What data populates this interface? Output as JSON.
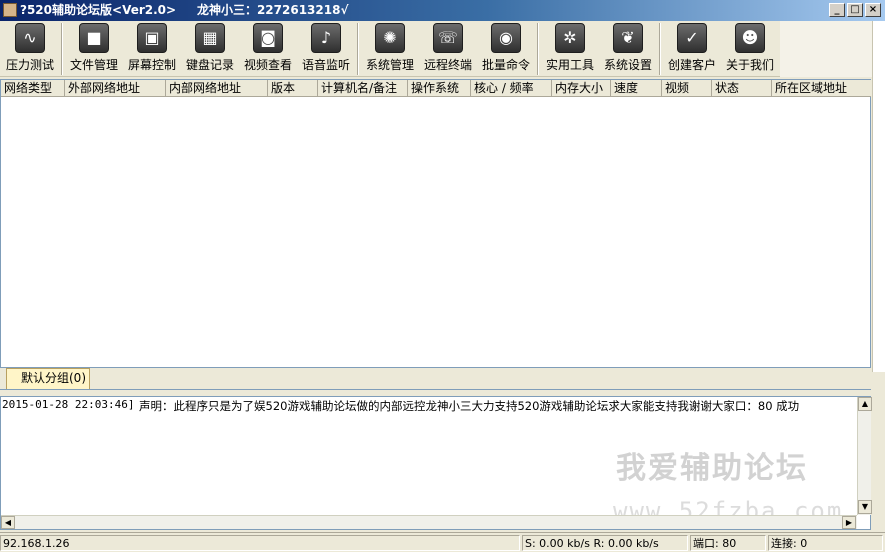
{
  "window": {
    "title": "?520辅助论坛版<Ver2.0>     龙神小三：2272613218√",
    "buttons": [
      "_",
      "□",
      "×"
    ]
  },
  "toolbar": {
    "items": [
      {
        "label": "压力测试",
        "icon": "pulse-icon"
      },
      {
        "label": "文件管理",
        "icon": "box-icon"
      },
      {
        "label": "屏幕控制",
        "icon": "photos-icon"
      },
      {
        "label": "键盘记录",
        "icon": "calendar-icon"
      },
      {
        "label": "视频查看",
        "icon": "camera-icon"
      },
      {
        "label": "语音监听",
        "icon": "microphone-icon"
      },
      {
        "label": "系统管理",
        "icon": "gears-icon"
      },
      {
        "label": "远程终端",
        "icon": "phone-icon"
      },
      {
        "label": "批量命令",
        "icon": "broadcast-icon"
      },
      {
        "label": "实用工具",
        "icon": "aperture-icon"
      },
      {
        "label": "系统设置",
        "icon": "leaf-icon"
      },
      {
        "label": "创建客户",
        "icon": "checkmark-icon"
      },
      {
        "label": "关于我们",
        "icon": "users-icon"
      }
    ]
  },
  "list": {
    "columns": [
      "网络类型",
      "外部网络地址",
      "内部网络地址",
      "版本",
      "计算机名/备注",
      "操作系统",
      "核心 / 频率",
      "内存大小",
      "速度",
      "视频",
      "状态",
      "所在区域地址"
    ]
  },
  "group_tab": {
    "label": "默认分组(0)"
  },
  "log": {
    "timestamp": "2015-01-28 22:03:46]",
    "message": "声明：此程序只是为了娱520游戏辅助论坛做的内部远控龙神小三大力支持520游戏辅助论坛求大家能支持我谢谢大家口：80 成功",
    "watermark_cn": "我爱辅助论坛",
    "watermark_url": "www.52fzba.com"
  },
  "statusbar": {
    "ip": "92.168.1.26",
    "speed": "S: 0.00 kb/s R: 0.00 kb/s",
    "port": "端口: 80",
    "connections": "连接: 0"
  }
}
